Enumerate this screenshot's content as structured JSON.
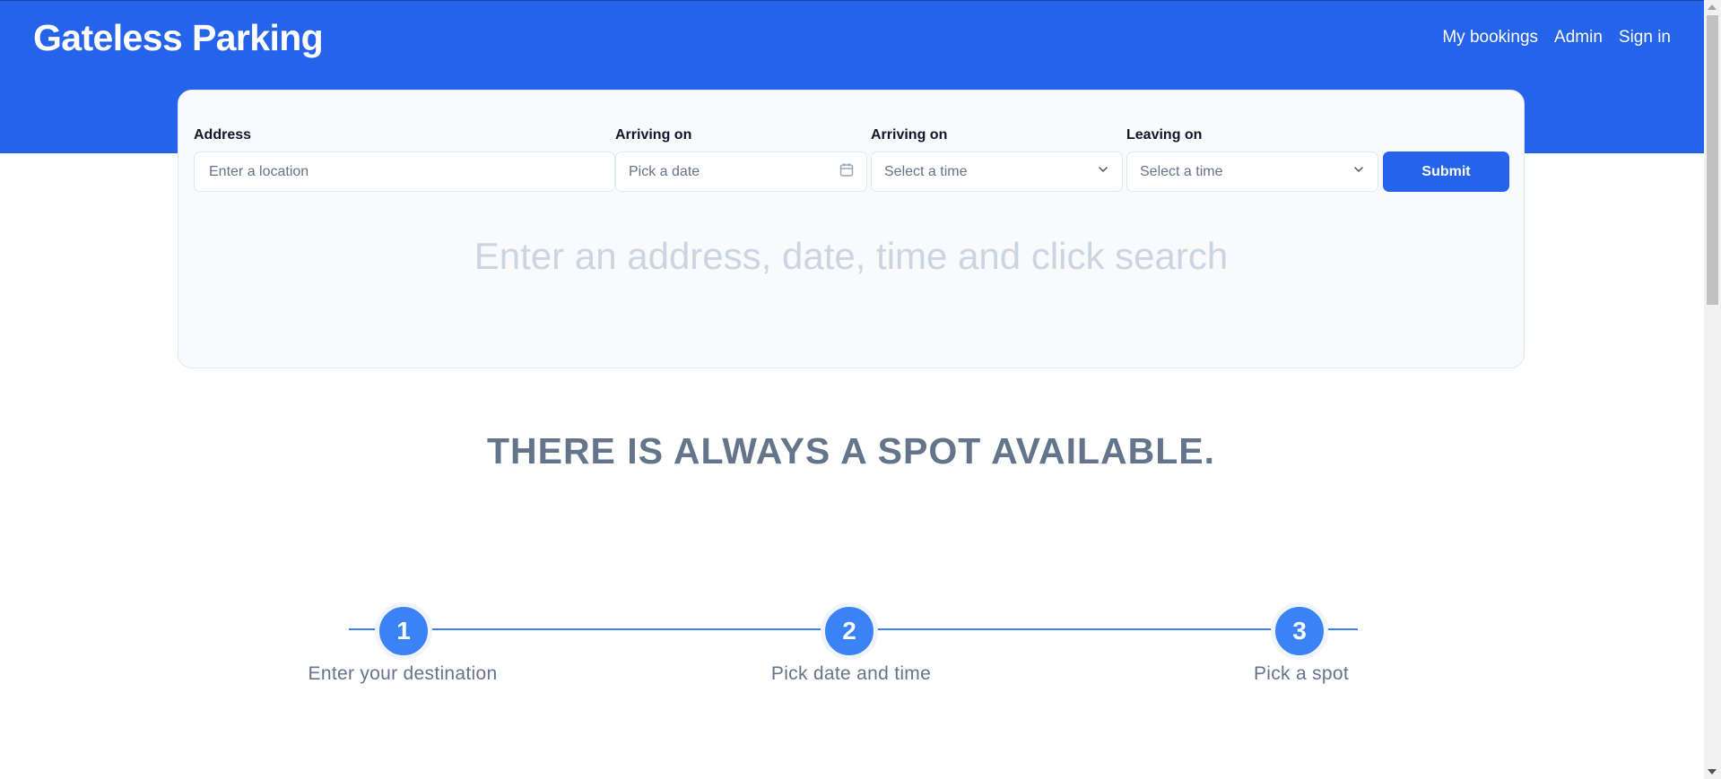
{
  "header": {
    "brand": "Gateless Parking",
    "nav": [
      "My bookings",
      "Admin",
      "Sign in"
    ]
  },
  "search": {
    "address_label": "Address",
    "address_placeholder": "Enter a location",
    "arrival_date_label": "Arriving on",
    "arrival_date_value": "Pick a date",
    "arrival_time_label": "Arriving on",
    "arrival_time_value": "Select a time",
    "leave_time_label": "Leaving on",
    "leave_time_value": "Select a time",
    "submit_label": "Submit",
    "hint": "Enter an address, date, time and click search"
  },
  "tagline": "THERE IS ALWAYS A SPOT AVAILABLE.",
  "steps": [
    {
      "number": "1",
      "label": "Enter your destination"
    },
    {
      "number": "2",
      "label": "Pick date and time"
    },
    {
      "number": "3",
      "label": "Pick a spot"
    }
  ],
  "icons": {
    "date": "calendar-icon",
    "time_select": "chevron-down-icon"
  },
  "colors": {
    "brand_blue": "#2563eb",
    "step_blue": "#3b82f6",
    "muted_text": "#64748b",
    "hint_text": "#cbd5e1"
  }
}
